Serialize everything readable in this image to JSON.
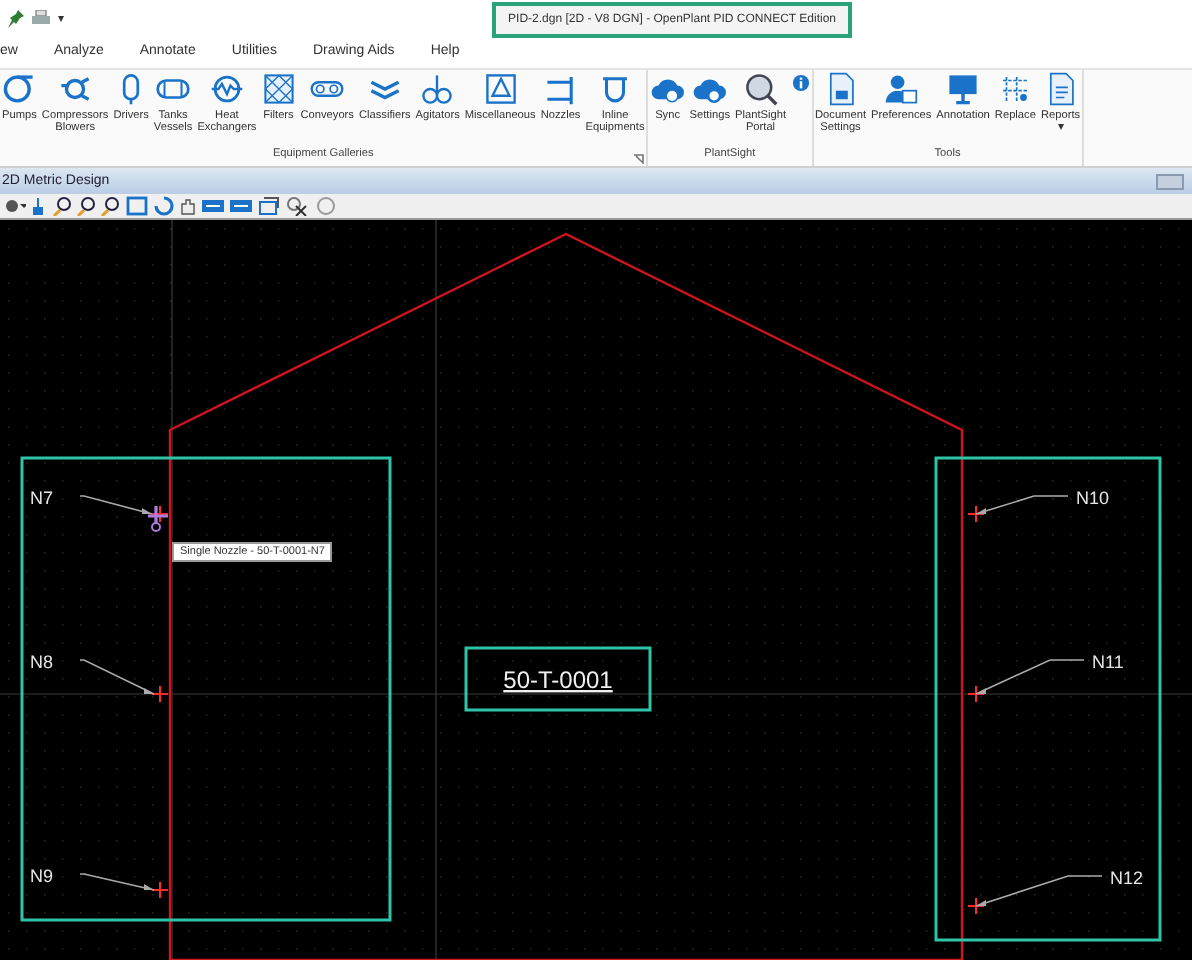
{
  "window": {
    "title": "PID-2.dgn [2D - V8 DGN] - OpenPlant PID CONNECT Edition"
  },
  "quick_access": {
    "dropdown": "▾"
  },
  "tabs": [
    {
      "label": "ew",
      "selected": false
    },
    {
      "label": "Analyze",
      "selected": false
    },
    {
      "label": "Annotate",
      "selected": false
    },
    {
      "label": "Utilities",
      "selected": false
    },
    {
      "label": "Drawing Aids",
      "selected": false
    },
    {
      "label": "Help",
      "selected": false
    }
  ],
  "ribbon_groups": [
    {
      "title": "Equipment Galleries",
      "buttons": [
        {
          "label": "Pumps"
        },
        {
          "label": "Compressors\nBlowers"
        },
        {
          "label": "Drivers"
        },
        {
          "label": "Tanks\nVessels"
        },
        {
          "label": "Heat\nExchangers"
        },
        {
          "label": "Filters"
        },
        {
          "label": "Conveyors"
        },
        {
          "label": "Classifiers"
        },
        {
          "label": "Agitators"
        },
        {
          "label": "Miscellaneous"
        },
        {
          "label": "Nozzles"
        },
        {
          "label": "Inline\nEquipments"
        }
      ]
    },
    {
      "title": "PlantSight",
      "buttons": [
        {
          "label": "Sync"
        },
        {
          "label": "Settings"
        },
        {
          "label": "PlantSight\nPortal"
        }
      ]
    },
    {
      "title": "Tools",
      "buttons": [
        {
          "label": "Document\nSettings"
        },
        {
          "label": "Preferences"
        },
        {
          "label": "Annotation"
        },
        {
          "label": "Replace"
        },
        {
          "label": "Reports",
          "dropdown": "▾"
        }
      ]
    }
  ],
  "view": {
    "title": "2D Metric Design",
    "equipment_tag": "50-T-0001",
    "nozzle_labels": [
      "N7",
      "N8",
      "N9",
      "N10",
      "N11",
      "N12"
    ],
    "tooltip": "Single Nozzle - 50-T-0001-N7"
  }
}
